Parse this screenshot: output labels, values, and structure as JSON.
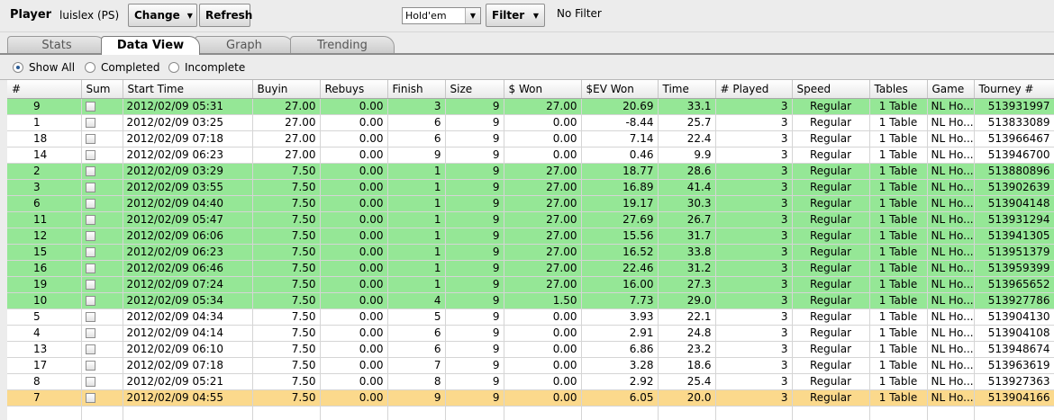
{
  "toolbar": {
    "player_label": "Player",
    "player_name": "luislex (PS)",
    "change_label": "Change",
    "refresh_label": "Refresh",
    "game_select": "Hold'em",
    "filter_label": "Filter",
    "filter_status": "No Filter"
  },
  "tabs": [
    "Stats",
    "Data View",
    "Graph",
    "Trending"
  ],
  "active_tab": "Data View",
  "radios": [
    "Show All",
    "Completed",
    "Incomplete"
  ],
  "selected_radio": "Show All",
  "colors": {
    "win_row": "#95e796",
    "selected_row": "#fbd98c"
  },
  "table": {
    "headers": [
      "#",
      "Sum",
      "Start Time",
      "Buyin",
      "Rebuys",
      "Finish",
      "Size",
      "$ Won",
      "$EV Won",
      "Time",
      "# Played",
      "Speed",
      "Tables",
      "Game",
      "Tourney #"
    ],
    "rows": [
      {
        "status": "win",
        "cells": [
          "9",
          "",
          "2012/02/09 05:31",
          "27.00",
          "0.00",
          "3",
          "9",
          "27.00",
          "20.69",
          "33.1",
          "3",
          "Regular",
          "1 Table",
          "NL Ho...",
          "513931997"
        ]
      },
      {
        "status": "",
        "cells": [
          "1",
          "",
          "2012/02/09 03:25",
          "27.00",
          "0.00",
          "6",
          "9",
          "0.00",
          "-8.44",
          "25.7",
          "3",
          "Regular",
          "1 Table",
          "NL Ho...",
          "513833089"
        ]
      },
      {
        "status": "",
        "cells": [
          "18",
          "",
          "2012/02/09 07:18",
          "27.00",
          "0.00",
          "6",
          "9",
          "0.00",
          "7.14",
          "22.4",
          "3",
          "Regular",
          "1 Table",
          "NL Ho...",
          "513966467"
        ]
      },
      {
        "status": "",
        "cells": [
          "14",
          "",
          "2012/02/09 06:23",
          "27.00",
          "0.00",
          "9",
          "9",
          "0.00",
          "0.46",
          "9.9",
          "3",
          "Regular",
          "1 Table",
          "NL Ho...",
          "513946700"
        ]
      },
      {
        "status": "win",
        "cells": [
          "2",
          "",
          "2012/02/09 03:29",
          "7.50",
          "0.00",
          "1",
          "9",
          "27.00",
          "18.77",
          "28.6",
          "3",
          "Regular",
          "1 Table",
          "NL Ho...",
          "513880896"
        ]
      },
      {
        "status": "win",
        "cells": [
          "3",
          "",
          "2012/02/09 03:55",
          "7.50",
          "0.00",
          "1",
          "9",
          "27.00",
          "16.89",
          "41.4",
          "3",
          "Regular",
          "1 Table",
          "NL Ho...",
          "513902639"
        ]
      },
      {
        "status": "win",
        "cells": [
          "6",
          "",
          "2012/02/09 04:40",
          "7.50",
          "0.00",
          "1",
          "9",
          "27.00",
          "19.17",
          "30.3",
          "3",
          "Regular",
          "1 Table",
          "NL Ho...",
          "513904148"
        ]
      },
      {
        "status": "win",
        "cells": [
          "11",
          "",
          "2012/02/09 05:47",
          "7.50",
          "0.00",
          "1",
          "9",
          "27.00",
          "27.69",
          "26.7",
          "3",
          "Regular",
          "1 Table",
          "NL Ho...",
          "513931294"
        ]
      },
      {
        "status": "win",
        "cells": [
          "12",
          "",
          "2012/02/09 06:06",
          "7.50",
          "0.00",
          "1",
          "9",
          "27.00",
          "15.56",
          "31.7",
          "3",
          "Regular",
          "1 Table",
          "NL Ho...",
          "513941305"
        ]
      },
      {
        "status": "win",
        "cells": [
          "15",
          "",
          "2012/02/09 06:23",
          "7.50",
          "0.00",
          "1",
          "9",
          "27.00",
          "16.52",
          "33.8",
          "3",
          "Regular",
          "1 Table",
          "NL Ho...",
          "513951379"
        ]
      },
      {
        "status": "win",
        "cells": [
          "16",
          "",
          "2012/02/09 06:46",
          "7.50",
          "0.00",
          "1",
          "9",
          "27.00",
          "22.46",
          "31.2",
          "3",
          "Regular",
          "1 Table",
          "NL Ho...",
          "513959399"
        ]
      },
      {
        "status": "win",
        "cells": [
          "19",
          "",
          "2012/02/09 07:24",
          "7.50",
          "0.00",
          "1",
          "9",
          "27.00",
          "16.00",
          "27.3",
          "3",
          "Regular",
          "1 Table",
          "NL Ho...",
          "513965652"
        ]
      },
      {
        "status": "win",
        "cells": [
          "10",
          "",
          "2012/02/09 05:34",
          "7.50",
          "0.00",
          "4",
          "9",
          "1.50",
          "7.73",
          "29.0",
          "3",
          "Regular",
          "1 Table",
          "NL Ho...",
          "513927786"
        ]
      },
      {
        "status": "",
        "cells": [
          "5",
          "",
          "2012/02/09 04:34",
          "7.50",
          "0.00",
          "5",
          "9",
          "0.00",
          "3.93",
          "22.1",
          "3",
          "Regular",
          "1 Table",
          "NL Ho...",
          "513904130"
        ]
      },
      {
        "status": "",
        "cells": [
          "4",
          "",
          "2012/02/09 04:14",
          "7.50",
          "0.00",
          "6",
          "9",
          "0.00",
          "2.91",
          "24.8",
          "3",
          "Regular",
          "1 Table",
          "NL Ho...",
          "513904108"
        ]
      },
      {
        "status": "",
        "cells": [
          "13",
          "",
          "2012/02/09 06:10",
          "7.50",
          "0.00",
          "6",
          "9",
          "0.00",
          "6.86",
          "23.2",
          "3",
          "Regular",
          "1 Table",
          "NL Ho...",
          "513948674"
        ]
      },
      {
        "status": "",
        "cells": [
          "17",
          "",
          "2012/02/09 07:18",
          "7.50",
          "0.00",
          "7",
          "9",
          "0.00",
          "3.28",
          "18.6",
          "3",
          "Regular",
          "1 Table",
          "NL Ho...",
          "513963619"
        ]
      },
      {
        "status": "",
        "cells": [
          "8",
          "",
          "2012/02/09 05:21",
          "7.50",
          "0.00",
          "8",
          "9",
          "0.00",
          "2.92",
          "25.4",
          "3",
          "Regular",
          "1 Table",
          "NL Ho...",
          "513927363"
        ]
      },
      {
        "status": "sel",
        "cells": [
          "7",
          "",
          "2012/02/09 04:55",
          "7.50",
          "0.00",
          "9",
          "9",
          "0.00",
          "6.05",
          "20.0",
          "3",
          "Regular",
          "1 Table",
          "NL Ho...",
          "513904166"
        ]
      }
    ]
  }
}
